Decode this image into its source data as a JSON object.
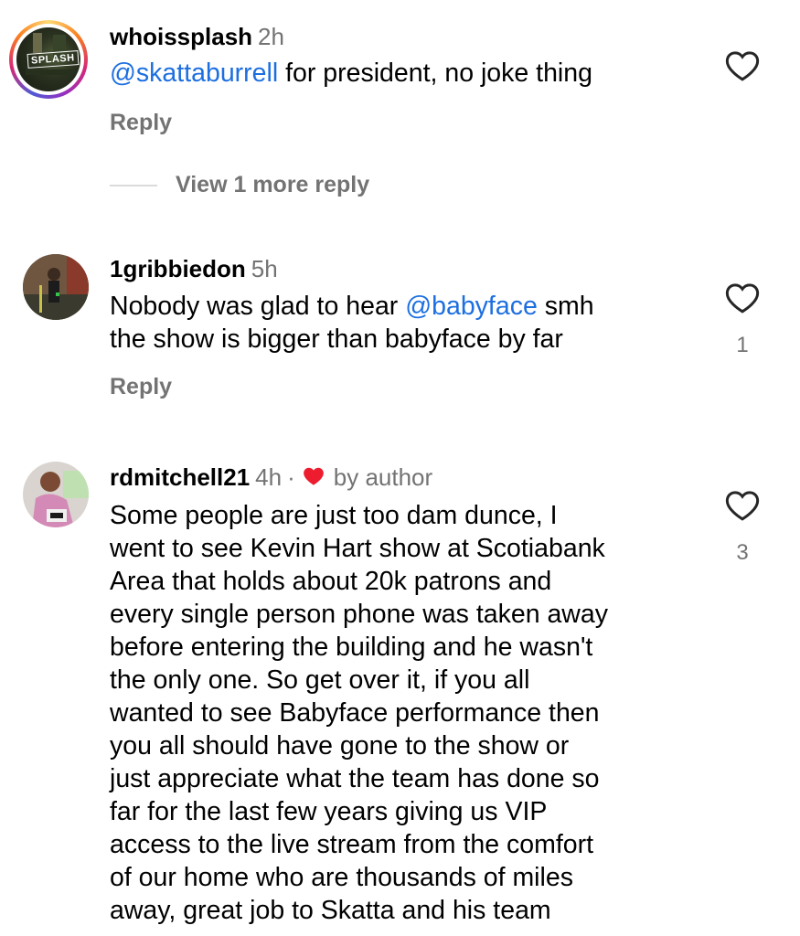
{
  "comments": [
    {
      "username": "whoissplash",
      "time": "2h",
      "mention": "@skattaburrell",
      "text": " for president, no joke thing",
      "reply_label": "Reply",
      "avatar_text": "SPLASH",
      "view_more": "View 1 more reply"
    },
    {
      "username": "1gribbiedon",
      "time": "5h",
      "text_before": "Nobody was glad to hear ",
      "mention": "@babyface",
      "text_after": " smh",
      "line2": "the show is bigger than babyface by far",
      "reply_label": "Reply",
      "likes": "1"
    },
    {
      "username": "rdmitchell21",
      "time": "4h",
      "dot": "·",
      "author_tag": "by author",
      "lines": [
        "Some people are just too dam dunce, I",
        "went to  see Kevin Hart show at Scotiabank",
        "Area that holds about 20k patrons and",
        "every single person phone was taken away",
        "before entering the building and he wasn't",
        "the only one. So get over it, if you all",
        "wanted to see Babyface performance then",
        "you all should have gone to the show or",
        "just appreciate what the team has done so",
        "far for the last few years giving us VIP",
        "access to the live stream from the comfort",
        "of our home who are thousands of miles",
        "away, great job to Skatta and his team"
      ],
      "likes": "3"
    }
  ],
  "colors": {
    "mention": "#1d6fe0",
    "secondary": "#737373",
    "author_heart": "#ed1c2e"
  },
  "icons": {
    "like": "heart-outline-icon",
    "author_like": "heart-filled-icon"
  }
}
